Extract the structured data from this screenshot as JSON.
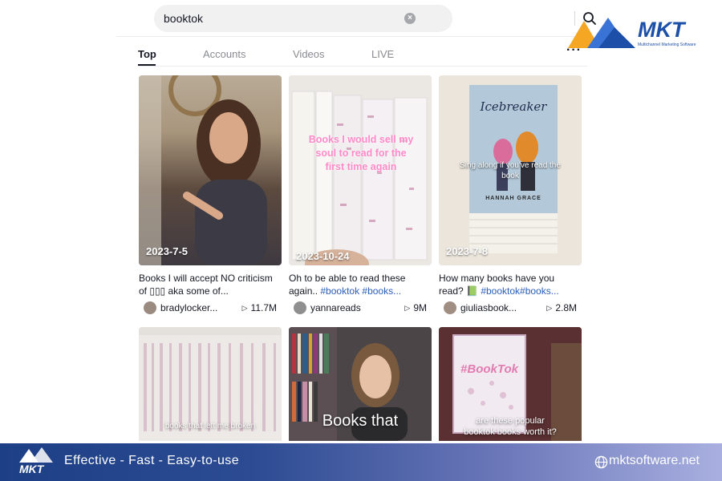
{
  "search": {
    "query": "booktok"
  },
  "tabs": [
    {
      "label": "Top",
      "active": true
    },
    {
      "label": "Accounts"
    },
    {
      "label": "Videos"
    },
    {
      "label": "LIVE"
    }
  ],
  "more_label": "···",
  "videos": [
    {
      "date": "2023-7-5",
      "caption": "Books I will accept NO criticism of ▯▯▯ aka some of...",
      "user": "bradylocker...",
      "views": "11.7M"
    },
    {
      "date": "2023-10-24",
      "overlay": "Books I would sell my soul to read for the first time again",
      "caption_plain": "Oh to be able to read these again.. ",
      "caption_tags": "#booktok #books...",
      "user": "yannareads",
      "views": "9M"
    },
    {
      "date": "2023-7-8",
      "overlay": "Sing along if you've read the book",
      "book_title": "Icebreaker",
      "book_author": "HANNAH GRACE",
      "caption_plain": "How many books have you read? 📗 ",
      "caption_tags": "#booktok#books...",
      "user": "giuliasbook...",
      "views": "2.8M"
    }
  ],
  "bottom_row": [
    {
      "overlay": "books that left me broken"
    },
    {
      "overlay": "Books that"
    },
    {
      "overlay": "are these popular booktok books worth it?",
      "sign": "#BookTok"
    }
  ],
  "brand": {
    "logo": "MKT",
    "logo_sub": "Multichannel Marketing Software"
  },
  "footer": {
    "logo": "MKT",
    "tagline": "Effective - Fast - Easy-to-use",
    "site": "mktsoftware.net"
  },
  "colors": {
    "accent": "#1c4fa8",
    "tag": "#2b5db9",
    "logo_orange": "#f5a623"
  }
}
